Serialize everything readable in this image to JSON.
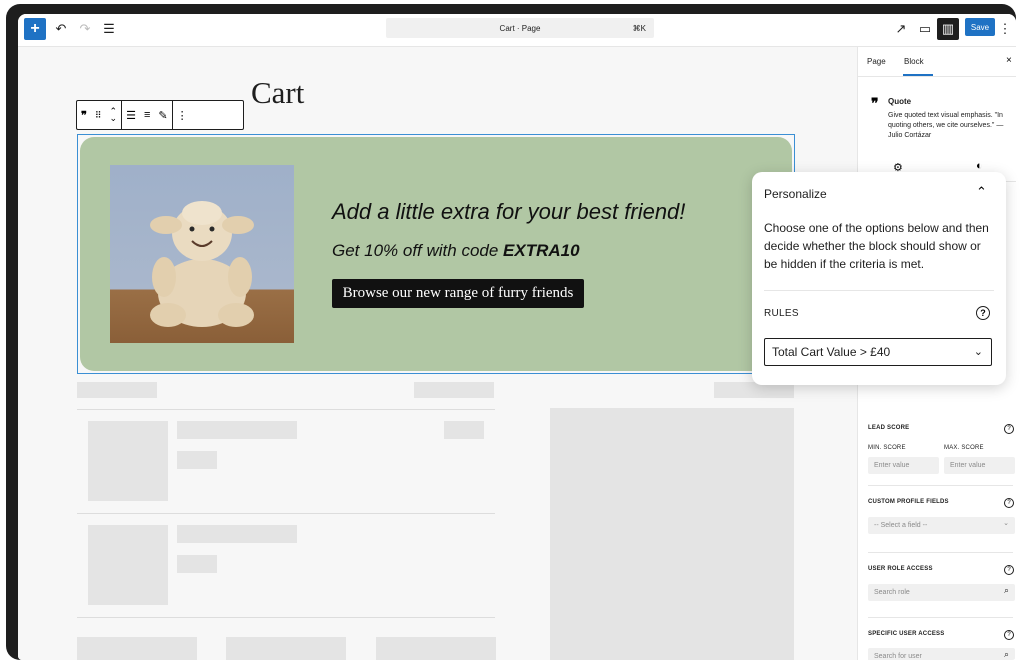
{
  "topbar": {
    "add_icon": "+",
    "undo_icon": "↶",
    "redo_icon": "↷",
    "list_view_icon": "☰",
    "command_title": "Cart · Page",
    "command_shortcut": "⌘K",
    "external_icon": "↗",
    "preview_icon": "▭",
    "settings_icon": "▥",
    "save_label": "Save",
    "more_icon": "⋮"
  },
  "canvas": {
    "page_title": "Cart",
    "quote": {
      "line1": "Add a little extra for your best friend!",
      "line2_prefix": "Get 10% off with code ",
      "line2_code": "EXTRA10",
      "button_label": "Browse our new range of furry friends"
    }
  },
  "sidebar": {
    "tab_page": "Page",
    "tab_block": "Block",
    "close_icon": "×",
    "block_icon": "❞",
    "block_title": "Quote",
    "block_description": "Give quoted text visual emphasis. \"In quoting others, we cite ourselves.\" — Julio Cortázar",
    "settings_tab_icon": "⚙",
    "styles_tab_icon": "◐",
    "lead_score_label": "LEAD SCORE",
    "min_score_label": "MIN. SCORE",
    "max_score_label": "MAX. SCORE",
    "min_score_placeholder": "Enter value",
    "max_score_placeholder": "Enter value",
    "custom_fields_label": "CUSTOM PROFILE FIELDS",
    "custom_fields_placeholder": "-- Select a field --",
    "role_access_label": "USER ROLE ACCESS",
    "role_placeholder": "Search role",
    "user_access_label": "SPECIFIC USER ACCESS",
    "user_placeholder": "Search for user",
    "help_icon": "?",
    "search_icon": "⌕",
    "chevron_icon": "⌄"
  },
  "popover": {
    "title": "Personalize",
    "collapse_icon": "⌃",
    "description": "Choose one of the options below and then decide whether the block should show or be hidden if the criteria is met.",
    "rules_label": "RULES",
    "help_icon": "?",
    "rule_selected": "Total Cart Value > £40",
    "select_chevron": "⌄"
  },
  "colors": {
    "accent": "#1f72c4",
    "quote_background": "#b1c7a4",
    "frame": "#1e1e1e"
  }
}
